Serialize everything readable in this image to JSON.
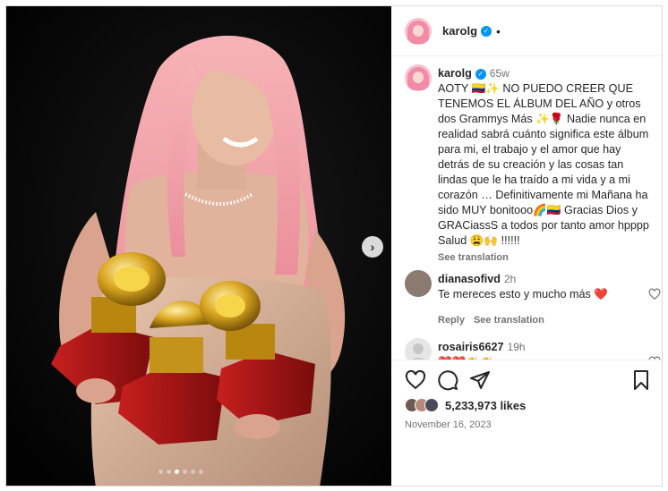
{
  "post": {
    "username": "karolg",
    "header_separator": "•"
  },
  "media": {
    "next_icon": "chevron-right-icon",
    "next_symbol": "›",
    "carousel_total": 6,
    "carousel_active": 2
  },
  "caption": {
    "username": "karolg",
    "time": "65w",
    "text": "AOTY 🇨🇴✨ NO PUEDO CREER QUE TENEMOS EL ÁLBUM DEL AÑO y otros dos Grammys Más ✨🌹 Nadie nunca en realidad sabrá cuánto significa este álbum para mi, el trabajo y el amor que hay detrás de su creación y las cosas tan lindas que le ha traído a mi vida y a mi corazón … Definitivamente mi Mañana ha sido MUY bonitooo🌈🇨🇴 Gracias Dios y GRACiassS a todos por tanto amor hpppp Salud 😩🙌 !!!!!!",
    "see_translation": "See translation"
  },
  "comments": [
    {
      "username": "dianasofivd",
      "time": "2h",
      "text": "Te mereces esto y mucho más ❤️",
      "reply": "Reply",
      "see_translation": "See translation"
    },
    {
      "username": "rosairis6627",
      "time": "19h",
      "text": "❤️❤️👏👏"
    }
  ],
  "actions": {
    "like_icon": "heart-outline-icon",
    "comment_icon": "comment-bubble-icon",
    "share_icon": "paper-plane-icon",
    "save_icon": "bookmark-icon"
  },
  "likes": {
    "count_text": "5,233,973 likes"
  },
  "date": "November 16, 2023",
  "colors": {
    "verified": "#0095f6",
    "heart_red": "#ed4956",
    "muted": "#737373"
  }
}
